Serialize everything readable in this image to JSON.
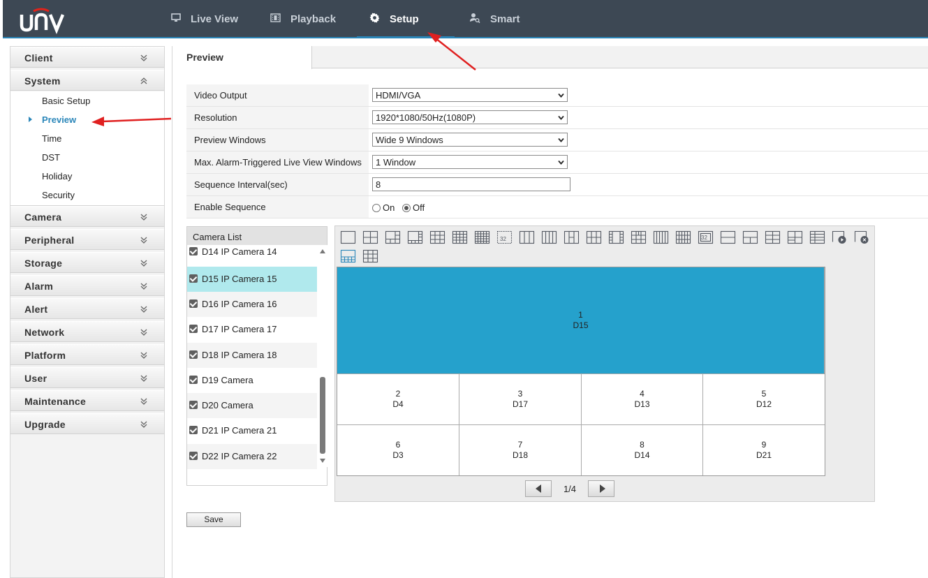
{
  "header": {
    "logo": "UNV",
    "nav": [
      {
        "label": "Live View",
        "icon": "monitor-icon"
      },
      {
        "label": "Playback",
        "icon": "film-icon"
      },
      {
        "label": "Setup",
        "icon": "gear-icon"
      },
      {
        "label": "Smart",
        "icon": "person-search-icon"
      }
    ],
    "active": "Setup"
  },
  "sidebar": {
    "groups": [
      {
        "label": "Client",
        "expanded": false
      },
      {
        "label": "System",
        "expanded": true
      },
      {
        "label": "Camera",
        "expanded": false
      },
      {
        "label": "Peripheral",
        "expanded": false
      },
      {
        "label": "Storage",
        "expanded": false
      },
      {
        "label": "Alarm",
        "expanded": false
      },
      {
        "label": "Alert",
        "expanded": false
      },
      {
        "label": "Network",
        "expanded": false
      },
      {
        "label": "Platform",
        "expanded": false
      },
      {
        "label": "User",
        "expanded": false
      },
      {
        "label": "Maintenance",
        "expanded": false
      },
      {
        "label": "Upgrade",
        "expanded": false
      }
    ],
    "system_items": [
      "Basic Setup",
      "Preview",
      "Time",
      "DST",
      "Holiday",
      "Security"
    ],
    "active_item": "Preview"
  },
  "tab": {
    "label": "Preview"
  },
  "form": {
    "video_output": {
      "label": "Video Output",
      "value": "HDMI/VGA"
    },
    "resolution": {
      "label": "Resolution",
      "value": "1920*1080/50Hz(1080P)"
    },
    "preview_windows": {
      "label": "Preview Windows",
      "value": "Wide 9 Windows"
    },
    "max_alarm": {
      "label": "Max. Alarm-Triggered Live View Windows",
      "value": "1 Window"
    },
    "sequence_interval": {
      "label": "Sequence Interval(sec)",
      "value": "8"
    },
    "enable_sequence": {
      "label": "Enable Sequence",
      "on_label": "On",
      "off_label": "Off",
      "selected": "Off"
    }
  },
  "camera_list": {
    "title": "Camera List",
    "items": [
      {
        "label": "D14 IP Camera 14",
        "checked": true
      },
      {
        "label": "D15 IP Camera 15",
        "checked": true,
        "selected": true
      },
      {
        "label": "D16 IP Camera 16",
        "checked": true
      },
      {
        "label": "D17 IP Camera 17",
        "checked": true
      },
      {
        "label": "D18 IP Camera 18",
        "checked": true
      },
      {
        "label": "D19 Camera",
        "checked": true
      },
      {
        "label": "D20 Camera",
        "checked": true
      },
      {
        "label": "D21 IP Camera 21",
        "checked": true
      },
      {
        "label": "D22 IP Camera 22",
        "checked": true
      }
    ]
  },
  "preview": {
    "windows": [
      {
        "num": "1",
        "cam": "D15"
      },
      {
        "num": "2",
        "cam": "D4"
      },
      {
        "num": "3",
        "cam": "D17"
      },
      {
        "num": "4",
        "cam": "D13"
      },
      {
        "num": "5",
        "cam": "D12"
      },
      {
        "num": "6",
        "cam": "D3"
      },
      {
        "num": "7",
        "cam": "D18"
      },
      {
        "num": "8",
        "cam": "D14"
      },
      {
        "num": "9",
        "cam": "D21"
      }
    ],
    "page_text": "1/4",
    "highlight_color": "#25a1cc"
  },
  "save_label": "Save"
}
